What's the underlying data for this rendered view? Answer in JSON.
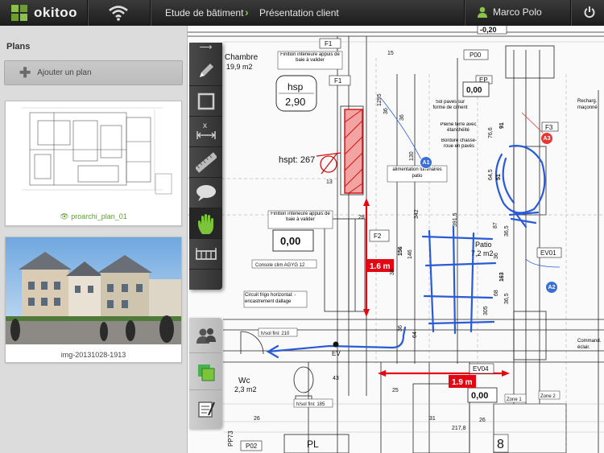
{
  "app": {
    "brand": "okitoo",
    "breadcrumb": [
      "Etude de bâtiment",
      "Présentation client"
    ],
    "user_name": "Marco Polo",
    "colors": {
      "accent": "#8bc34a",
      "measure": "#e30613",
      "annot_blue": "#2a5bd7",
      "pin_blue": "#3b6fd8",
      "pin_red": "#e53935"
    }
  },
  "sidebar": {
    "title": "Plans",
    "add_label": "Ajouter un plan",
    "plans": [
      {
        "label": "proarchi_plan_01",
        "active": true,
        "icon": "eye-icon"
      },
      {
        "label": "img-20131028-1913",
        "active": false
      }
    ]
  },
  "toolbar": {
    "tools": [
      "collapse-arrow-icon",
      "pencil-icon",
      "rectangle-icon",
      "dimension-icon",
      "ruler-icon",
      "comment-bubble-icon",
      "hand-icon",
      "wall-icon"
    ],
    "active_tool": "hand-icon"
  },
  "layers": {
    "items": [
      "users-icon",
      "layers-icon",
      "notes-icon"
    ]
  },
  "plan": {
    "rooms": [
      {
        "name": "Chambre",
        "area": "19,9 m2"
      },
      {
        "name": "Patio",
        "area": "7,2 m2"
      },
      {
        "name": "Wc",
        "area": "2,3 m2"
      }
    ],
    "tags": [
      "F1",
      "F1",
      "F2",
      "F3",
      "P00",
      "EP",
      "EV01",
      "EV04",
      "EV",
      "PP73",
      "P02",
      "PL",
      "8"
    ],
    "notes": [
      "Finition intérieure appuis de baie à valider",
      "Finition intérieure appuis de baie à valider",
      "Sol pavés sur forme de ciment",
      "Pleine terre avec étanchéité",
      "Bordure chasse-roue en pavés",
      "alimentation luminaires patio",
      "Console clim AGYG 12",
      "Circuit frigo horizontal: -encastrement dallage",
      "h/sol fini: 210",
      "h/sol fini: 185",
      "Zone 1",
      "Zone 2",
      "Recharg. maçonné",
      "Command. éclair."
    ],
    "levels": {
      "hsp_label": "hsp",
      "hsp_value": "2,90",
      "hspt_label": "hspt: 267",
      "values": [
        "0,00",
        "0,00",
        "0,00",
        "-0,20"
      ]
    },
    "measures": [
      "1.6 m",
      "1.9 m"
    ],
    "pins": [
      "A1",
      "A2",
      "A3"
    ],
    "dims": [
      "1295",
      "36",
      "76,6",
      "91",
      "64,5",
      "51",
      "87",
      "36,5",
      "36",
      "163",
      "68",
      "36,5",
      "36",
      "342",
      "146",
      "156",
      "391,5",
      "305",
      "217,8",
      "36",
      "15",
      "13",
      "64",
      "28",
      "130",
      "36",
      "26",
      "43",
      "25",
      "31",
      "26"
    ]
  }
}
